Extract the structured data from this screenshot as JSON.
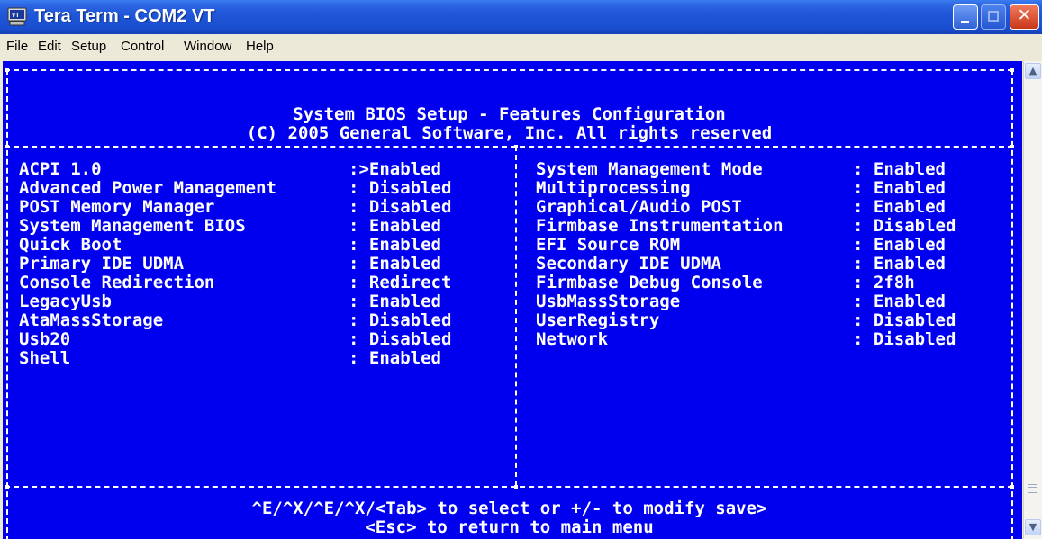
{
  "window": {
    "title": "Tera Term - COM2 VT",
    "minimize_icon": "minimize-icon",
    "maximize_icon": "maximize-icon",
    "close_icon": "close-icon",
    "close_glyph": "✕"
  },
  "menu": [
    "File",
    "Edit",
    "Setup",
    "Control",
    "Window",
    "Help"
  ],
  "bios": {
    "title": "System BIOS Setup - Features Configuration",
    "copyright": "(C) 2005 General Software, Inc. All rights reserved",
    "left": [
      {
        "label": "ACPI 1.0",
        "value": ":>Enabled"
      },
      {
        "label": "Advanced Power Management",
        "value": ": Disabled"
      },
      {
        "label": "POST Memory Manager",
        "value": ": Disabled"
      },
      {
        "label": "System Management BIOS",
        "value": ": Enabled"
      },
      {
        "label": "Quick Boot",
        "value": ": Enabled"
      },
      {
        "label": "Primary IDE UDMA",
        "value": ": Enabled"
      },
      {
        "label": "Console Redirection",
        "value": ": Redirect"
      },
      {
        "label": "LegacyUsb",
        "value": ": Enabled"
      },
      {
        "label": "AtaMassStorage",
        "value": ": Disabled"
      },
      {
        "label": "Usb20",
        "value": ": Disabled"
      },
      {
        "label": "Shell",
        "value": ": Enabled"
      }
    ],
    "right": [
      {
        "label": "System Management Mode",
        "value": ": Enabled"
      },
      {
        "label": "Multiprocessing",
        "value": ": Enabled"
      },
      {
        "label": "Graphical/Audio POST",
        "value": ": Enabled"
      },
      {
        "label": "Firmbase Instrumentation",
        "value": ": Disabled"
      },
      {
        "label": "EFI Source ROM",
        "value": ": Enabled"
      },
      {
        "label": "Secondary IDE UDMA",
        "value": ": Enabled"
      },
      {
        "label": "Firmbase Debug Console",
        "value": ": 2f8h"
      },
      {
        "label": "UsbMassStorage",
        "value": ": Enabled"
      },
      {
        "label": "UserRegistry",
        "value": ": Disabled"
      },
      {
        "label": "Network",
        "value": ": Disabled"
      }
    ],
    "help_line_1": "^E/^X/^E/^X/<Tab> to select or +/- to modify save>",
    "help_line_2": "<Esc> to return to main menu"
  },
  "scrollbar": {
    "up_icon": "scroll-up-arrow-icon",
    "down_icon": "scroll-down-arrow-icon",
    "up_glyph": "▲",
    "down_glyph": "▼"
  },
  "colors": {
    "terminal_bg": "#0000ef",
    "terminal_fg": "#ffffff",
    "titlebar": "#1e54d6",
    "menubar": "#ece9d8"
  }
}
